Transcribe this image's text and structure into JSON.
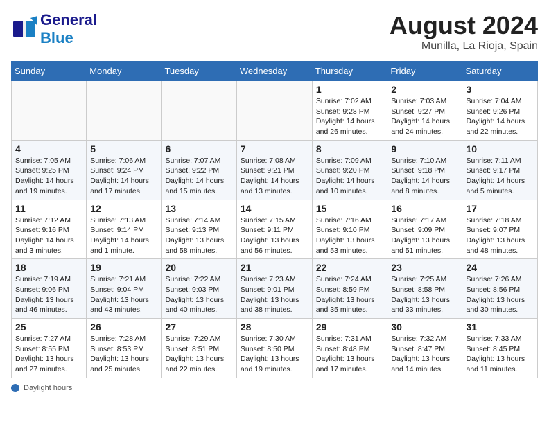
{
  "header": {
    "logo_general": "General",
    "logo_blue": "Blue",
    "month_year": "August 2024",
    "location": "Munilla, La Rioja, Spain"
  },
  "weekdays": [
    "Sunday",
    "Monday",
    "Tuesday",
    "Wednesday",
    "Thursday",
    "Friday",
    "Saturday"
  ],
  "footer_label": "Daylight hours",
  "days": [
    {
      "num": "",
      "info": ""
    },
    {
      "num": "",
      "info": ""
    },
    {
      "num": "",
      "info": ""
    },
    {
      "num": "",
      "info": ""
    },
    {
      "num": "1",
      "info": "Sunrise: 7:02 AM\nSunset: 9:28 PM\nDaylight: 14 hours and 26 minutes."
    },
    {
      "num": "2",
      "info": "Sunrise: 7:03 AM\nSunset: 9:27 PM\nDaylight: 14 hours and 24 minutes."
    },
    {
      "num": "3",
      "info": "Sunrise: 7:04 AM\nSunset: 9:26 PM\nDaylight: 14 hours and 22 minutes."
    },
    {
      "num": "4",
      "info": "Sunrise: 7:05 AM\nSunset: 9:25 PM\nDaylight: 14 hours and 19 minutes."
    },
    {
      "num": "5",
      "info": "Sunrise: 7:06 AM\nSunset: 9:24 PM\nDaylight: 14 hours and 17 minutes."
    },
    {
      "num": "6",
      "info": "Sunrise: 7:07 AM\nSunset: 9:22 PM\nDaylight: 14 hours and 15 minutes."
    },
    {
      "num": "7",
      "info": "Sunrise: 7:08 AM\nSunset: 9:21 PM\nDaylight: 14 hours and 13 minutes."
    },
    {
      "num": "8",
      "info": "Sunrise: 7:09 AM\nSunset: 9:20 PM\nDaylight: 14 hours and 10 minutes."
    },
    {
      "num": "9",
      "info": "Sunrise: 7:10 AM\nSunset: 9:18 PM\nDaylight: 14 hours and 8 minutes."
    },
    {
      "num": "10",
      "info": "Sunrise: 7:11 AM\nSunset: 9:17 PM\nDaylight: 14 hours and 5 minutes."
    },
    {
      "num": "11",
      "info": "Sunrise: 7:12 AM\nSunset: 9:16 PM\nDaylight: 14 hours and 3 minutes."
    },
    {
      "num": "12",
      "info": "Sunrise: 7:13 AM\nSunset: 9:14 PM\nDaylight: 14 hours and 1 minute."
    },
    {
      "num": "13",
      "info": "Sunrise: 7:14 AM\nSunset: 9:13 PM\nDaylight: 13 hours and 58 minutes."
    },
    {
      "num": "14",
      "info": "Sunrise: 7:15 AM\nSunset: 9:11 PM\nDaylight: 13 hours and 56 minutes."
    },
    {
      "num": "15",
      "info": "Sunrise: 7:16 AM\nSunset: 9:10 PM\nDaylight: 13 hours and 53 minutes."
    },
    {
      "num": "16",
      "info": "Sunrise: 7:17 AM\nSunset: 9:09 PM\nDaylight: 13 hours and 51 minutes."
    },
    {
      "num": "17",
      "info": "Sunrise: 7:18 AM\nSunset: 9:07 PM\nDaylight: 13 hours and 48 minutes."
    },
    {
      "num": "18",
      "info": "Sunrise: 7:19 AM\nSunset: 9:06 PM\nDaylight: 13 hours and 46 minutes."
    },
    {
      "num": "19",
      "info": "Sunrise: 7:21 AM\nSunset: 9:04 PM\nDaylight: 13 hours and 43 minutes."
    },
    {
      "num": "20",
      "info": "Sunrise: 7:22 AM\nSunset: 9:03 PM\nDaylight: 13 hours and 40 minutes."
    },
    {
      "num": "21",
      "info": "Sunrise: 7:23 AM\nSunset: 9:01 PM\nDaylight: 13 hours and 38 minutes."
    },
    {
      "num": "22",
      "info": "Sunrise: 7:24 AM\nSunset: 8:59 PM\nDaylight: 13 hours and 35 minutes."
    },
    {
      "num": "23",
      "info": "Sunrise: 7:25 AM\nSunset: 8:58 PM\nDaylight: 13 hours and 33 minutes."
    },
    {
      "num": "24",
      "info": "Sunrise: 7:26 AM\nSunset: 8:56 PM\nDaylight: 13 hours and 30 minutes."
    },
    {
      "num": "25",
      "info": "Sunrise: 7:27 AM\nSunset: 8:55 PM\nDaylight: 13 hours and 27 minutes."
    },
    {
      "num": "26",
      "info": "Sunrise: 7:28 AM\nSunset: 8:53 PM\nDaylight: 13 hours and 25 minutes."
    },
    {
      "num": "27",
      "info": "Sunrise: 7:29 AM\nSunset: 8:51 PM\nDaylight: 13 hours and 22 minutes."
    },
    {
      "num": "28",
      "info": "Sunrise: 7:30 AM\nSunset: 8:50 PM\nDaylight: 13 hours and 19 minutes."
    },
    {
      "num": "29",
      "info": "Sunrise: 7:31 AM\nSunset: 8:48 PM\nDaylight: 13 hours and 17 minutes."
    },
    {
      "num": "30",
      "info": "Sunrise: 7:32 AM\nSunset: 8:47 PM\nDaylight: 13 hours and 14 minutes."
    },
    {
      "num": "31",
      "info": "Sunrise: 7:33 AM\nSunset: 8:45 PM\nDaylight: 13 hours and 11 minutes."
    }
  ]
}
